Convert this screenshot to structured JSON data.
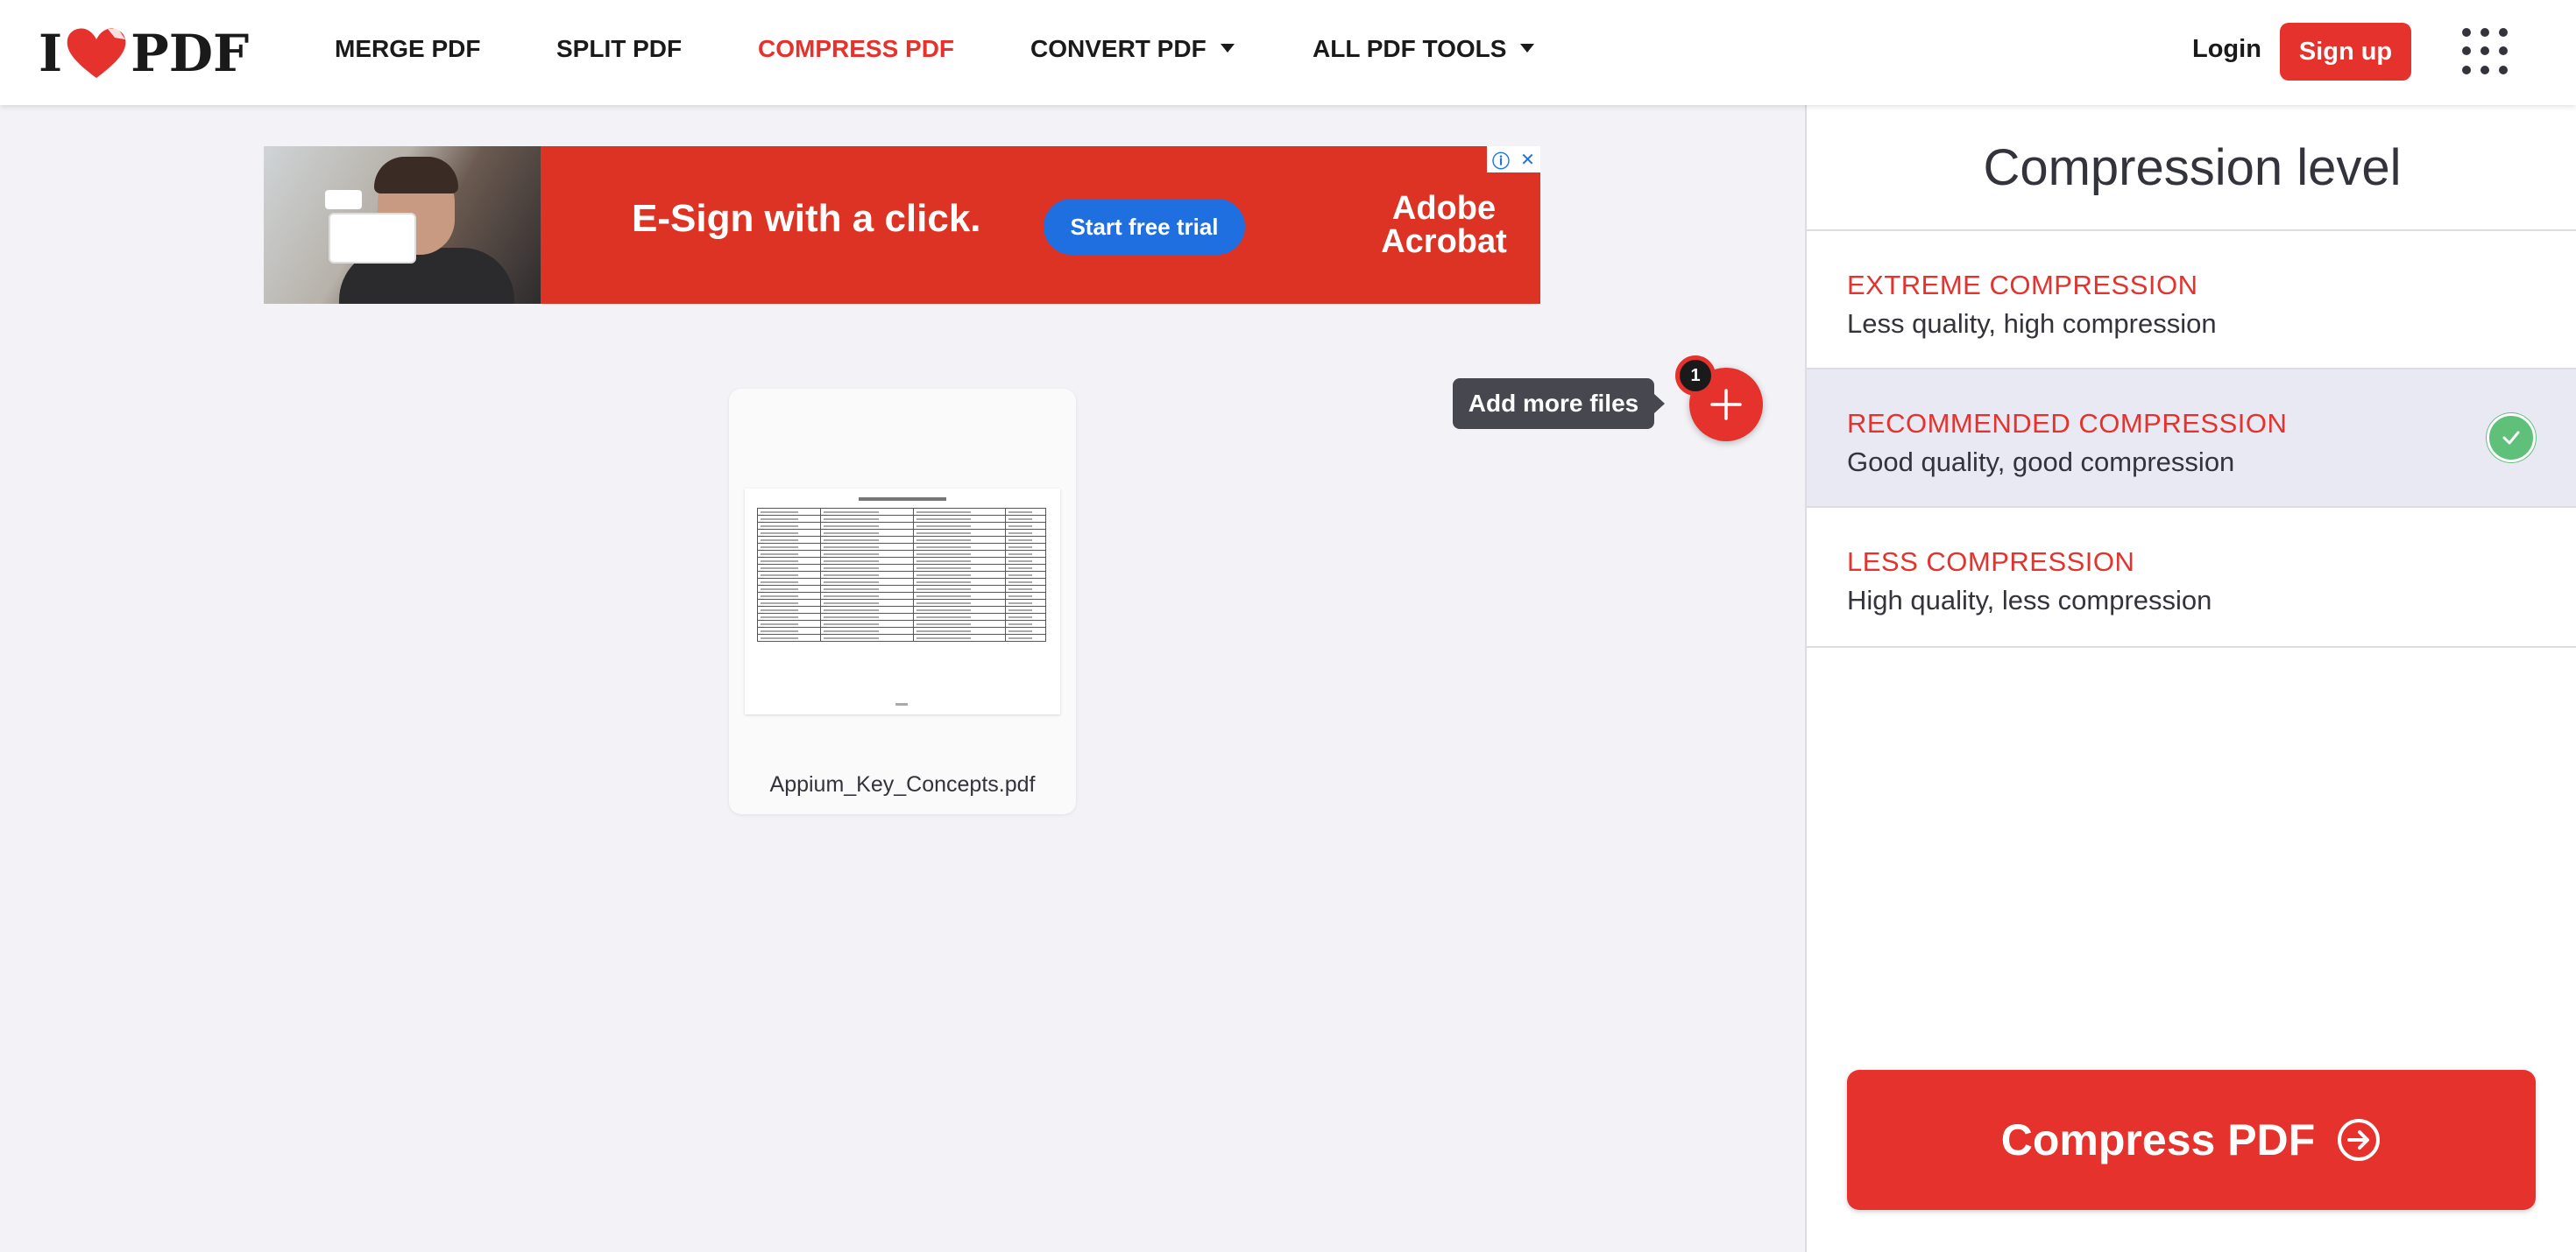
{
  "header": {
    "logo": {
      "left": "I",
      "right": "PDF"
    },
    "nav": [
      {
        "label": "MERGE PDF",
        "active": false,
        "dropdown": false
      },
      {
        "label": "SPLIT PDF",
        "active": false,
        "dropdown": false
      },
      {
        "label": "COMPRESS PDF",
        "active": true,
        "dropdown": false
      },
      {
        "label": "CONVERT PDF",
        "active": false,
        "dropdown": true
      },
      {
        "label": "ALL PDF TOOLS",
        "active": false,
        "dropdown": true
      }
    ],
    "login_label": "Login",
    "signup_label": "Sign up"
  },
  "ad": {
    "headline": "E-Sign with a click.",
    "cta_label": "Start free trial",
    "brand_line1": "Adobe",
    "brand_line2": "Acrobat",
    "info_symbol": "ⓘ",
    "close_symbol": "✕"
  },
  "file": {
    "name": "Appium_Key_Concepts.pdf"
  },
  "add_files": {
    "tooltip": "Add more files",
    "count": "1"
  },
  "sidebar": {
    "title": "Compression level",
    "options": [
      {
        "title": "EXTREME COMPRESSION",
        "desc": "Less quality, high compression",
        "selected": false
      },
      {
        "title": "RECOMMENDED COMPRESSION",
        "desc": "Good quality, good compression",
        "selected": true
      },
      {
        "title": "LESS COMPRESSION",
        "desc": "High quality, less compression",
        "selected": false
      }
    ],
    "action_label": "Compress PDF"
  },
  "colors": {
    "brand_red": "#e5322d",
    "selected_bg": "#e8e9f3",
    "check_green": "#5fc07a",
    "ad_red": "#dc3324",
    "ad_button_blue": "#1f6fe0"
  },
  "icons": {
    "logo_heart": "heart-icon",
    "dropdown": "caret-down-icon",
    "apps": "apps-grid-icon",
    "add": "plus-icon",
    "selected": "check-icon",
    "action": "arrow-right-circle-icon"
  }
}
